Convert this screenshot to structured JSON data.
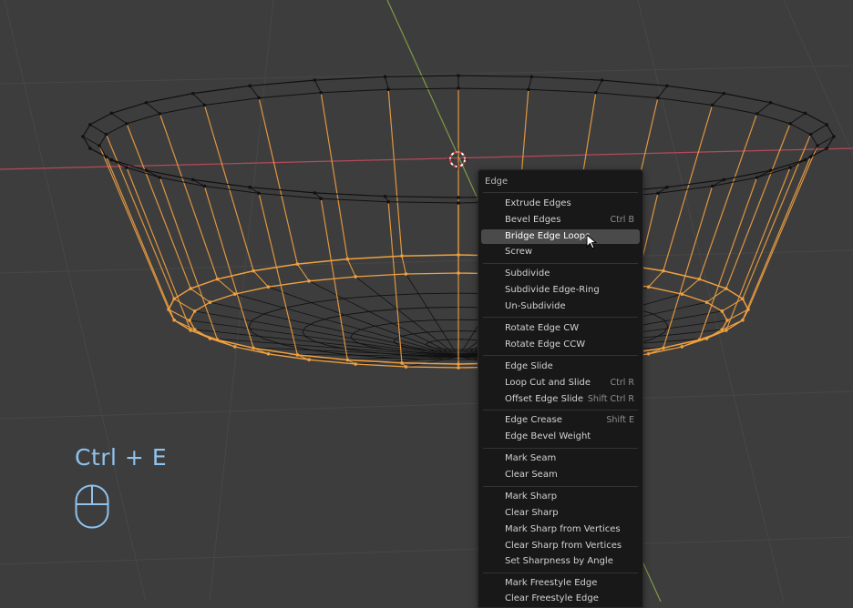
{
  "shortcut_overlay": {
    "text": "Ctrl + E",
    "icon": "mouse-icon"
  },
  "menu": {
    "title": "Edge",
    "items": [
      {
        "label": "Extrude Edges",
        "shortcut": ""
      },
      {
        "label": "Bevel Edges",
        "shortcut": "Ctrl B"
      },
      {
        "label": "Bridge Edge Loops",
        "shortcut": "",
        "highlighted": true
      },
      {
        "label": "Screw",
        "shortcut": ""
      },
      {
        "label": "Subdivide",
        "shortcut": ""
      },
      {
        "label": "Subdivide Edge-Ring",
        "shortcut": ""
      },
      {
        "label": "Un-Subdivide",
        "shortcut": ""
      },
      {
        "label": "Rotate Edge CW",
        "shortcut": ""
      },
      {
        "label": "Rotate Edge CCW",
        "shortcut": ""
      },
      {
        "label": "Edge Slide",
        "shortcut": ""
      },
      {
        "label": "Loop Cut and Slide",
        "shortcut": "Ctrl R"
      },
      {
        "label": "Offset Edge Slide",
        "shortcut": "Shift Ctrl R"
      },
      {
        "label": "Edge Crease",
        "shortcut": "Shift E"
      },
      {
        "label": "Edge Bevel Weight",
        "shortcut": ""
      },
      {
        "label": "Mark Seam",
        "shortcut": ""
      },
      {
        "label": "Clear Seam",
        "shortcut": ""
      },
      {
        "label": "Mark Sharp",
        "shortcut": ""
      },
      {
        "label": "Clear Sharp",
        "shortcut": ""
      },
      {
        "label": "Mark Sharp from Vertices",
        "shortcut": ""
      },
      {
        "label": "Clear Sharp from Vertices",
        "shortcut": ""
      },
      {
        "label": "Set Sharpness by Angle",
        "shortcut": ""
      },
      {
        "label": "Mark Freestyle Edge",
        "shortcut": ""
      },
      {
        "label": "Clear Freestyle Edge",
        "shortcut": ""
      }
    ]
  },
  "colors": {
    "viewport_bg": "#3d3d3d",
    "selected_edge": "#f0a040",
    "wire": "#111111",
    "x_axis": "#b44a5a",
    "y_axis": "#7f9a45",
    "overlay_text": "#8fc3ee"
  }
}
